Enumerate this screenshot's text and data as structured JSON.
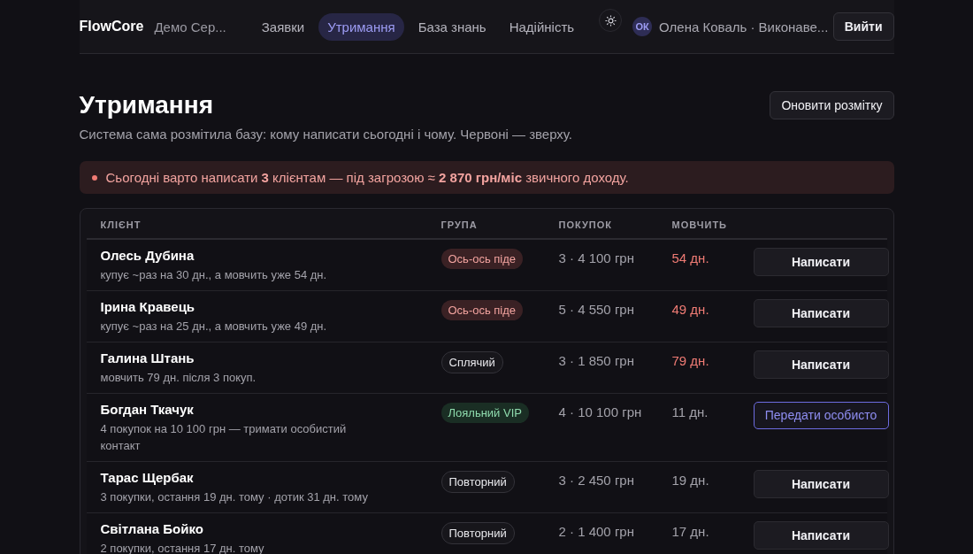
{
  "header": {
    "brand": "FlowCore",
    "workspace": "Демо Сер...",
    "nav": [
      {
        "label": "Заявки",
        "selected": false
      },
      {
        "label": "Утримання",
        "selected": true
      },
      {
        "label": "База знань",
        "selected": false
      },
      {
        "label": "Надійність",
        "selected": false
      }
    ],
    "user": {
      "initials": "ОК",
      "name": "Олена Коваль · Виконаве..."
    },
    "logout": "Вийти"
  },
  "page": {
    "title": "Утримання",
    "subtitle": "Система сама розмітила базу: кому написати сьогодні і чому. Червоні — зверху.",
    "refresh": "Оновити розмітку"
  },
  "alert": {
    "text": "Сьогодні варто написати **3** клієнтам — під загрозою ≈ **2 870 грн/міс** звичного доходу."
  },
  "table": {
    "columns": [
      "КЛІЄНТ",
      "ГРУПА",
      "ПОКУПОК",
      "МОВЧИТЬ"
    ],
    "rows": [
      {
        "name": "Олесь Дубина",
        "note": "купує ~раз на 30 дн., а мовчить уже 54 дн.",
        "group": {
          "label": "Ось-ось піде",
          "kind": "risk"
        },
        "purchases": "3 · 4 100 грн",
        "silent": "54 дн.",
        "urgent": true,
        "action": {
          "label": "Написати",
          "kind": "write"
        }
      },
      {
        "name": "Ірина Кравець",
        "note": "купує ~раз на 25 дн., а мовчить уже 49 дн.",
        "group": {
          "label": "Ось-ось піде",
          "kind": "risk"
        },
        "purchases": "5 · 4 550 грн",
        "silent": "49 дн.",
        "urgent": true,
        "action": {
          "label": "Написати",
          "kind": "write"
        }
      },
      {
        "name": "Галина Штань",
        "note": "мовчить 79 дн. після 3 покуп.",
        "group": {
          "label": "Сплячий",
          "kind": "neutral"
        },
        "purchases": "3 · 1 850 грн",
        "silent": "79 дн.",
        "urgent": true,
        "action": {
          "label": "Написати",
          "kind": "write"
        }
      },
      {
        "name": "Богдан Ткачук",
        "note": "4 покупок на 10 100 грн — тримати особистий контакт",
        "group": {
          "label": "Лояльний VIP",
          "kind": "vip"
        },
        "purchases": "4 · 10 100 грн",
        "silent": "11 дн.",
        "urgent": false,
        "action": {
          "label": "Передати особисто",
          "kind": "handoff"
        }
      },
      {
        "name": "Тарас Щербак",
        "note": "3 покупки, остання 19 дн. тому · дотик 31 дн. тому",
        "group": {
          "label": "Повторний",
          "kind": "neutral"
        },
        "purchases": "3 · 2 450 грн",
        "silent": "19 дн.",
        "urgent": false,
        "action": {
          "label": "Написати",
          "kind": "write"
        }
      },
      {
        "name": "Світлана Бойко",
        "note": "2 покупки, остання 17 дн. тому",
        "group": {
          "label": "Повторний",
          "kind": "neutral"
        },
        "purchases": "2 · 1 400 грн",
        "silent": "17 дн.",
        "urgent": false,
        "action": {
          "label": "Написати",
          "kind": "write"
        }
      }
    ]
  }
}
